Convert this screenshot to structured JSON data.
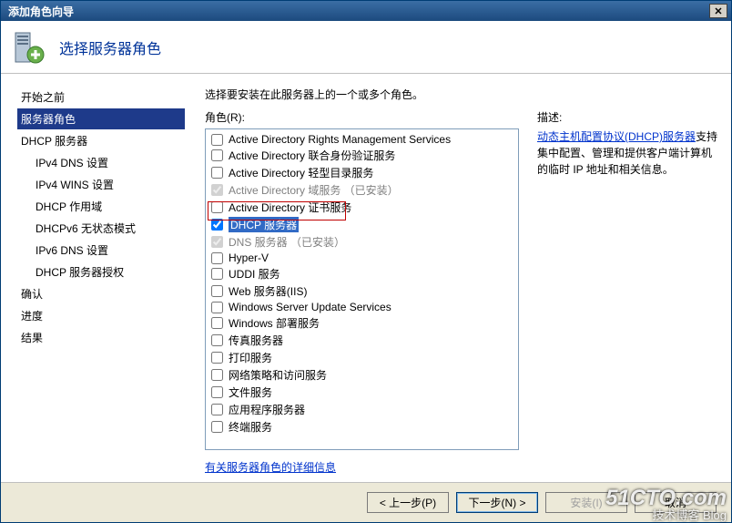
{
  "window": {
    "title": "添加角色向导",
    "close_label": "✕"
  },
  "header": {
    "title": "选择服务器角色"
  },
  "sidebar": {
    "items": [
      {
        "label": "开始之前",
        "indent": false,
        "selected": false
      },
      {
        "label": "服务器角色",
        "indent": false,
        "selected": true
      },
      {
        "label": "DHCP 服务器",
        "indent": false,
        "selected": false
      },
      {
        "label": "IPv4 DNS 设置",
        "indent": true,
        "selected": false
      },
      {
        "label": "IPv4 WINS 设置",
        "indent": true,
        "selected": false
      },
      {
        "label": "DHCP 作用域",
        "indent": true,
        "selected": false
      },
      {
        "label": "DHCPv6 无状态模式",
        "indent": true,
        "selected": false
      },
      {
        "label": "IPv6 DNS 设置",
        "indent": true,
        "selected": false
      },
      {
        "label": "DHCP 服务器授权",
        "indent": true,
        "selected": false
      },
      {
        "label": "确认",
        "indent": false,
        "selected": false
      },
      {
        "label": "进度",
        "indent": false,
        "selected": false
      },
      {
        "label": "结果",
        "indent": false,
        "selected": false
      }
    ]
  },
  "main": {
    "instruction": "选择要安装在此服务器上的一个或多个角色。",
    "roles_label": "角色(R):",
    "desc_label": "描述:",
    "details_link": "有关服务器角色的详细信息",
    "desc_link_text": "动态主机配置协议(DHCP)服务器",
    "desc_rest": "支持集中配置、管理和提供客户端计算机的临时 IP 地址和相关信息。"
  },
  "roles": [
    {
      "label": "Active Directory Rights Management Services",
      "checked": false,
      "disabled": false,
      "highlight": false
    },
    {
      "label": "Active Directory 联合身份验证服务",
      "checked": false,
      "disabled": false,
      "highlight": false
    },
    {
      "label": "Active Directory 轻型目录服务",
      "checked": false,
      "disabled": false,
      "highlight": false
    },
    {
      "label": "Active Directory 域服务 （已安装）",
      "checked": true,
      "disabled": true,
      "highlight": false
    },
    {
      "label": "Active Directory 证书服务",
      "checked": false,
      "disabled": false,
      "highlight": false
    },
    {
      "label": "DHCP 服务器",
      "checked": true,
      "disabled": false,
      "highlight": true
    },
    {
      "label": "DNS 服务器 （已安装）",
      "checked": true,
      "disabled": true,
      "highlight": false
    },
    {
      "label": "Hyper-V",
      "checked": false,
      "disabled": false,
      "highlight": false
    },
    {
      "label": "UDDI 服务",
      "checked": false,
      "disabled": false,
      "highlight": false
    },
    {
      "label": "Web 服务器(IIS)",
      "checked": false,
      "disabled": false,
      "highlight": false
    },
    {
      "label": "Windows Server Update Services",
      "checked": false,
      "disabled": false,
      "highlight": false
    },
    {
      "label": "Windows 部署服务",
      "checked": false,
      "disabled": false,
      "highlight": false
    },
    {
      "label": "传真服务器",
      "checked": false,
      "disabled": false,
      "highlight": false
    },
    {
      "label": "打印服务",
      "checked": false,
      "disabled": false,
      "highlight": false
    },
    {
      "label": "网络策略和访问服务",
      "checked": false,
      "disabled": false,
      "highlight": false
    },
    {
      "label": "文件服务",
      "checked": false,
      "disabled": false,
      "highlight": false
    },
    {
      "label": "应用程序服务器",
      "checked": false,
      "disabled": false,
      "highlight": false
    },
    {
      "label": "终端服务",
      "checked": false,
      "disabled": false,
      "highlight": false
    }
  ],
  "footer": {
    "prev": "< 上一步(P)",
    "next": "下一步(N) >",
    "install": "安装(I)",
    "cancel": "取消"
  },
  "watermark": {
    "line1": "51CTO.com",
    "line2": "技术博客  Blog"
  }
}
